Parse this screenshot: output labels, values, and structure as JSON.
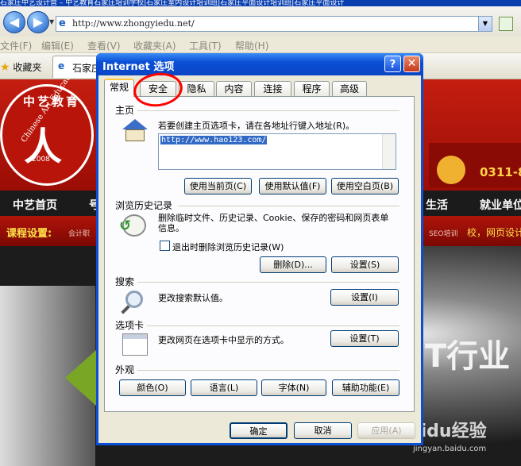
{
  "browser": {
    "title_strip": "石家庄中艺设计营 – 中艺教育石家庄培训学校|石家庄室内设计培训班|石家庄平面设计培训班|石家庄平面设计",
    "address_url": "http://www.zhongyiedu.net/",
    "menu": [
      "文件(F)",
      "编辑(E)",
      "查看(V)",
      "收藏夹(A)",
      "工具(T)",
      "帮助(H)"
    ],
    "favorites_label": "收藏夹",
    "tab_label": "石家庄"
  },
  "webpage": {
    "logo_ring_text": "Chinese Art Education",
    "logo_glyph": "人",
    "logo_year": "2008",
    "logo_cn": "中艺教育",
    "phone": "0311-8",
    "nav": [
      "中艺首页",
      "号",
      "生活",
      "就业单位"
    ],
    "course_label": "课程设置:",
    "course_sub_left": "会计职",
    "course_sub_right": "SEO培训",
    "course_hot": "校，网页设计",
    "banner_text": "IT行业",
    "watermark": "Baidu经验",
    "watermark_sub": "jingyan.baidu.com"
  },
  "dialog": {
    "title": "Internet 选项",
    "help": "?",
    "close": "✕",
    "tabs": [
      "常规",
      "安全",
      "隐私",
      "内容",
      "连接",
      "程序",
      "高级"
    ],
    "home": {
      "group": "主页",
      "desc": "若要创建主页选项卡，请在各地址行键入地址(R)。",
      "value": "http://www.hao123.com/",
      "btn_current": "使用当前页(C)",
      "btn_default": "使用默认值(F)",
      "btn_blank": "使用空白页(B)"
    },
    "history": {
      "group": "浏览历史记录",
      "desc": "删除临时文件、历史记录、Cookie、保存的密码和网页表单信息。",
      "checkbox_label": "退出时删除浏览历史记录(W)",
      "btn_delete": "删除(D)...",
      "btn_settings": "设置(S)"
    },
    "search": {
      "group": "搜索",
      "desc": "更改搜索默认值。",
      "btn_settings": "设置(I)"
    },
    "tabs_group": {
      "group": "选项卡",
      "desc": "更改网页在选项卡中显示的方式。",
      "btn_settings": "设置(T)"
    },
    "appearance": {
      "group": "外观",
      "btn_colors": "颜色(O)",
      "btn_languages": "语言(L)",
      "btn_fonts": "字体(N)",
      "btn_accessibility": "辅助功能(E)"
    },
    "footer": {
      "ok": "确定",
      "cancel": "取消",
      "apply": "应用(A)"
    }
  },
  "colors": {
    "annotation": "#ff0000",
    "title_bar": "#0a4fd6"
  }
}
